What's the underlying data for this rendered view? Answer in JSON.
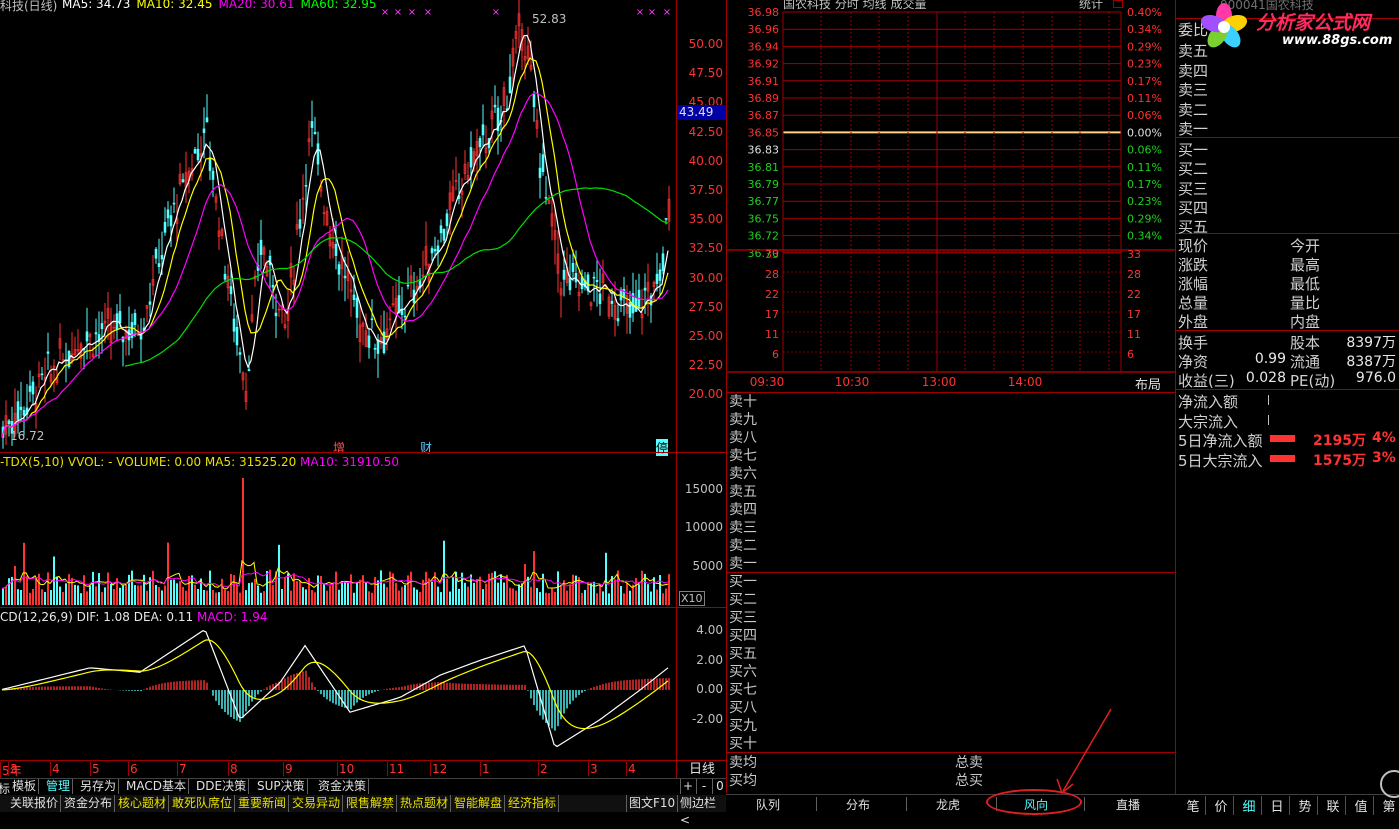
{
  "kline": {
    "title_fragment": "科技(日线)",
    "ma_legend": [
      {
        "label": "MA5: 34.73",
        "color": "#ffffff"
      },
      {
        "label": "MA10: 32.45",
        "color": "#ffff00"
      },
      {
        "label": "MA20: 30.61",
        "color": "#ff00ff"
      },
      {
        "label": "MA60: 32.95",
        "color": "#00ff00"
      }
    ],
    "y_ticks": [
      "50.00",
      "47.50",
      "45.00",
      "42.50",
      "40.00",
      "37.50",
      "35.00",
      "32.50",
      "30.00",
      "27.50",
      "25.00",
      "22.50",
      "20.00"
    ],
    "price_marker": "43.49",
    "high_label": "52.83",
    "low_label": "16.72",
    "event_marks": [
      "增",
      "财",
      "停"
    ]
  },
  "volume": {
    "legend": "-TDX(5,10) VVOL: -   VOLUME: 0.00  MA5: 31525.20",
    "legend_ma10": "MA10: 31910.50",
    "y_ticks": [
      "15000",
      "10000",
      "5000"
    ],
    "unit": "X10"
  },
  "macd": {
    "legend": "CD(12,26,9)  DIF: 1.08  DEA: 0.11",
    "legend_macd": "MACD: 1.94",
    "y_ticks": [
      "4.00",
      "2.00",
      "0.00",
      "-2.00"
    ]
  },
  "x_axis": {
    "labels": [
      "5年",
      "3",
      "4",
      "5",
      "6",
      "7",
      "8",
      "9",
      "10",
      "11",
      "12",
      "1",
      "2",
      "3",
      "4"
    ],
    "period": "日线"
  },
  "toolbar": {
    "left_partial": "标",
    "items": [
      "模板",
      "管理",
      "另存为",
      "MACD基本",
      "DDE决策",
      "SUP决策",
      "资金决策"
    ],
    "active": "管理",
    "right_controls": [
      "+",
      "-",
      "0"
    ]
  },
  "bottom_tabs": {
    "items": [
      "关联报价",
      "资金分布",
      "核心题材",
      "敢死队席位",
      "重要新闻",
      "交易异动",
      "限售解禁",
      "热点题材",
      "智能解盘",
      "经济指标"
    ],
    "mid": [
      "图文F10",
      "侧边栏<"
    ]
  },
  "intraday": {
    "title": "国农科技  分时  均线  成交量",
    "stat": "统计",
    "price_ticks": [
      "36.98",
      "36.96",
      "36.94",
      "36.92",
      "36.91",
      "36.89",
      "36.87",
      "36.85",
      "36.83",
      "36.81",
      "36.79",
      "36.77",
      "36.75",
      "36.72",
      "36.70"
    ],
    "pct_ticks": [
      "0.40%",
      "0.34%",
      "0.29%",
      "0.23%",
      "0.17%",
      "0.11%",
      "0.06%",
      "0.00%",
      "0.06%",
      "0.11%",
      "0.17%",
      "0.23%",
      "0.29%",
      "0.34%"
    ],
    "vol_ticks": [
      "33",
      "28",
      "22",
      "17",
      "11",
      "6"
    ],
    "time_ticks": [
      "09:30",
      "10:30",
      "13:00",
      "14:00"
    ],
    "layout_btn": "布局"
  },
  "order_queue": {
    "sells": [
      "卖十",
      "卖九",
      "卖八",
      "卖七",
      "卖六",
      "卖五",
      "卖四",
      "卖三",
      "卖二",
      "卖一"
    ],
    "buys": [
      "买一",
      "买二",
      "买三",
      "买四",
      "买五",
      "买六",
      "买七",
      "买八",
      "买九",
      "买十"
    ],
    "avg_sell": "卖均",
    "avg_buy": "买均",
    "total_sell": "总卖",
    "total_buy": "总买"
  },
  "mid_tabs": [
    "队列",
    "分布",
    "龙虎",
    "风向",
    "直播"
  ],
  "highlighted_tab": "风向",
  "quote": {
    "order_rows": [
      "委比",
      "卖五",
      "卖四",
      "卖三",
      "卖二",
      "卖一",
      "买一",
      "买二",
      "买三",
      "买四",
      "买五"
    ],
    "left_labels": [
      "现价",
      "涨跌",
      "涨幅",
      "总量",
      "外盘"
    ],
    "right_labels": [
      "今开",
      "最高",
      "最低",
      "量比",
      "内盘"
    ],
    "stats": [
      {
        "l": "换手",
        "v1": "",
        "m": "股本",
        "v2": "8397万"
      },
      {
        "l": "净资",
        "v1": "0.99",
        "m": "流通",
        "v2": "8387万"
      },
      {
        "l": "收益(三)",
        "v1": "0.028",
        "m": "PE(动)",
        "v2": "976.0"
      }
    ],
    "flow": [
      {
        "l": "净流入额",
        "v": "",
        "p": ""
      },
      {
        "l": "大宗流入",
        "v": "",
        "p": ""
      },
      {
        "l": "5日净流入额",
        "v": "2195万",
        "p": "4%"
      },
      {
        "l": "5日大宗流入",
        "v": "1575万",
        "p": "3%"
      }
    ]
  },
  "right_tabs": [
    "笔",
    "价",
    "细",
    "日",
    "势",
    "联",
    "值",
    "第"
  ],
  "right_active": "细",
  "watermark": {
    "title": "分析家公式网",
    "url": "www.88gs.com",
    "partial": "000041国农科技"
  },
  "colors": {
    "up": "#ff3232",
    "down": "#54ffff",
    "grid": "#a00000",
    "axis_text": "#ff3232",
    "tick_text": "#c0c0c0",
    "accent_blue": "#0000a8"
  }
}
